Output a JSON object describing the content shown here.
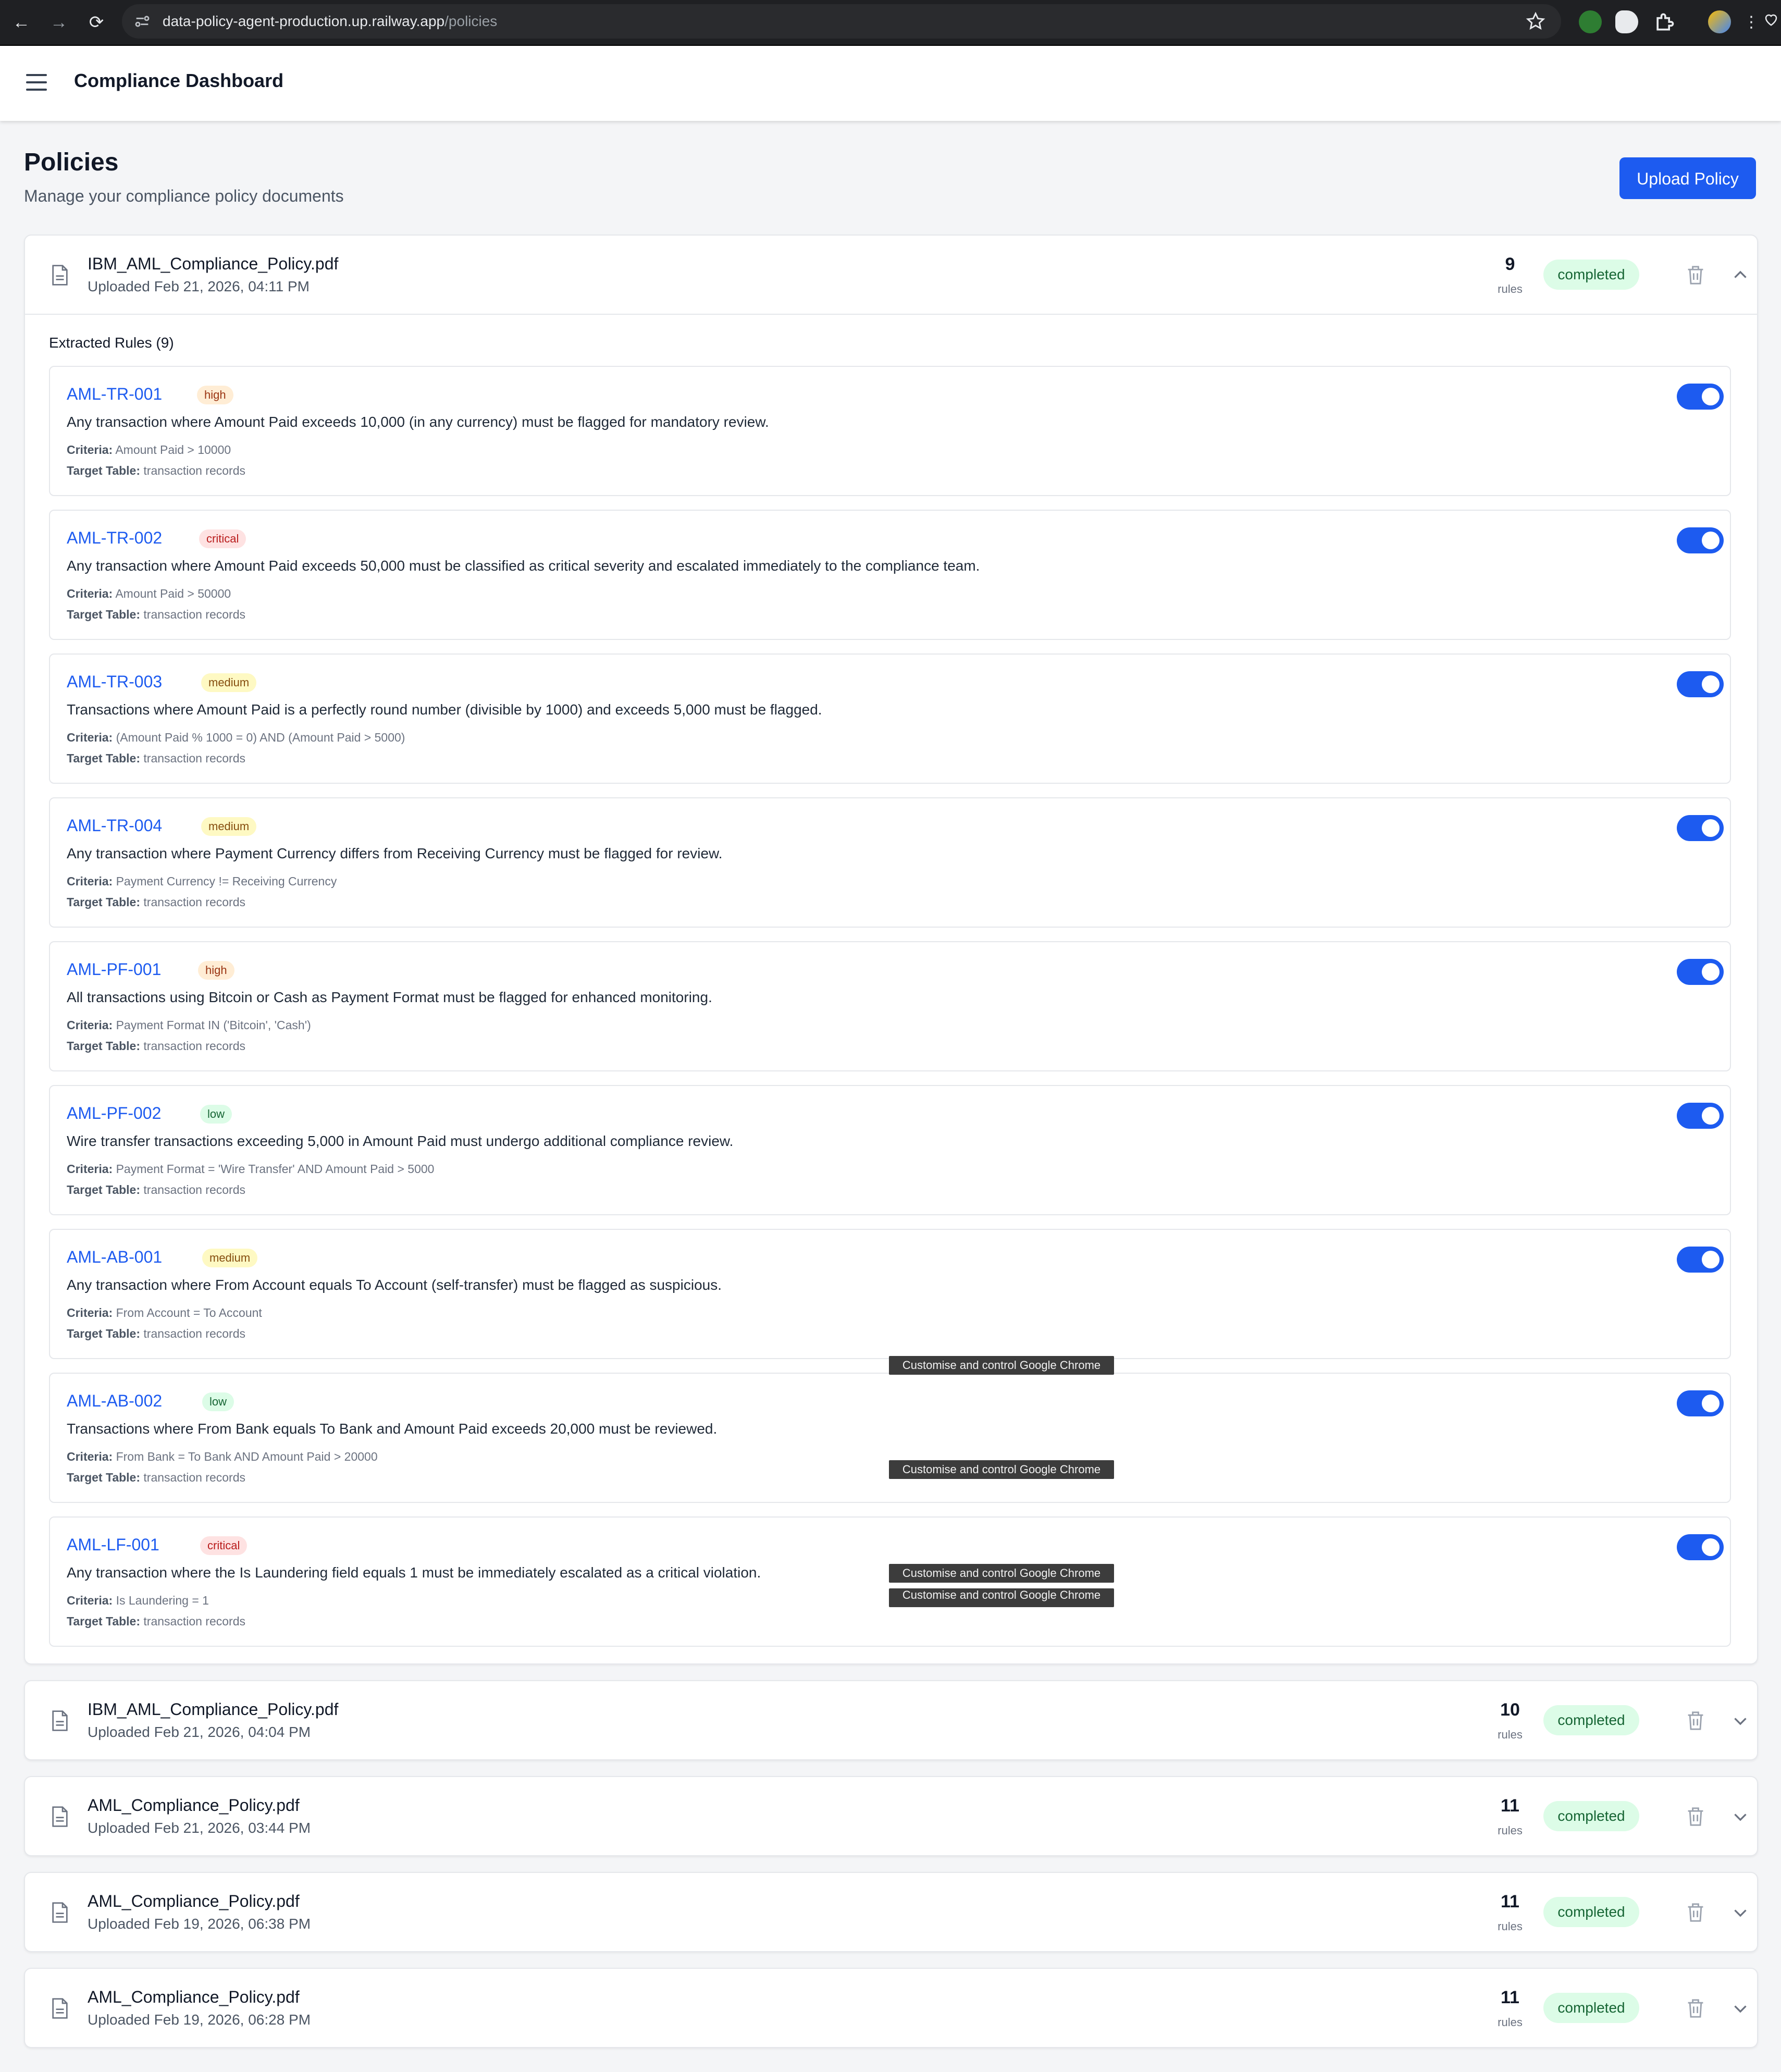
{
  "browser": {
    "url_host": "data-policy-agent-production.up.railway.app",
    "url_path": "/policies"
  },
  "app": {
    "title": "Compliance Dashboard"
  },
  "page": {
    "title": "Policies",
    "subtitle": "Manage your compliance policy documents",
    "upload_label": "Upload Policy"
  },
  "policies": [
    {
      "name": "IBM_AML_Compliance_Policy.pdf",
      "uploaded": "Uploaded Feb 21, 2026, 04:11 PM",
      "rule_count": "9",
      "rules_label": "rules",
      "status": "completed",
      "expanded": true,
      "rules_title": "Extracted Rules (9)",
      "rules": [
        {
          "id": "AML-TR-001",
          "severity": "high",
          "description": "Any transaction where Amount Paid exceeds 10,000 (in any currency) must be flagged for mandatory review.",
          "criteria_label": "Criteria:",
          "criteria": "Amount Paid > 10000",
          "table_label": "Target Table:",
          "table": "transaction records",
          "enabled": true
        },
        {
          "id": "AML-TR-002",
          "severity": "critical",
          "description": "Any transaction where Amount Paid exceeds 50,000 must be classified as critical severity and escalated immediately to the compliance team.",
          "criteria_label": "Criteria:",
          "criteria": "Amount Paid > 50000",
          "table_label": "Target Table:",
          "table": "transaction records",
          "enabled": true
        },
        {
          "id": "AML-TR-003",
          "severity": "medium",
          "description": "Transactions where Amount Paid is a perfectly round number (divisible by 1000) and exceeds 5,000 must be flagged.",
          "criteria_label": "Criteria:",
          "criteria": "(Amount Paid % 1000 = 0) AND (Amount Paid > 5000)",
          "table_label": "Target Table:",
          "table": "transaction records",
          "enabled": true
        },
        {
          "id": "AML-TR-004",
          "severity": "medium",
          "description": "Any transaction where Payment Currency differs from Receiving Currency must be flagged for review.",
          "criteria_label": "Criteria:",
          "criteria": "Payment Currency != Receiving Currency",
          "table_label": "Target Table:",
          "table": "transaction records",
          "enabled": true
        },
        {
          "id": "AML-PF-001",
          "severity": "high",
          "description": "All transactions using Bitcoin or Cash as Payment Format must be flagged for enhanced monitoring.",
          "criteria_label": "Criteria:",
          "criteria": "Payment Format IN ('Bitcoin', 'Cash')",
          "table_label": "Target Table:",
          "table": "transaction records",
          "enabled": true
        },
        {
          "id": "AML-PF-002",
          "severity": "low",
          "description": "Wire transfer transactions exceeding 5,000 in Amount Paid must undergo additional compliance review.",
          "criteria_label": "Criteria:",
          "criteria": "Payment Format = 'Wire Transfer' AND Amount Paid > 5000",
          "table_label": "Target Table:",
          "table": "transaction records",
          "enabled": true
        },
        {
          "id": "AML-AB-001",
          "severity": "medium",
          "description": "Any transaction where From Account equals To Account (self-transfer) must be flagged as suspicious.",
          "criteria_label": "Criteria:",
          "criteria": "From Account = To Account",
          "table_label": "Target Table:",
          "table": "transaction records",
          "enabled": true
        },
        {
          "id": "AML-AB-002",
          "severity": "low",
          "description": "Transactions where From Bank equals To Bank and Amount Paid exceeds 20,000 must be reviewed.",
          "criteria_label": "Criteria:",
          "criteria": "From Bank = To Bank AND Amount Paid > 20000",
          "table_label": "Target Table:",
          "table": "transaction records",
          "enabled": true
        },
        {
          "id": "AML-LF-001",
          "severity": "critical",
          "description": "Any transaction where the Is Laundering field equals 1 must be immediately escalated as a critical violation.",
          "criteria_label": "Criteria:",
          "criteria": "Is Laundering = 1",
          "table_label": "Target Table:",
          "table": "transaction records",
          "enabled": true
        }
      ]
    },
    {
      "name": "IBM_AML_Compliance_Policy.pdf",
      "uploaded": "Uploaded Feb 21, 2026, 04:04 PM",
      "rule_count": "10",
      "rules_label": "rules",
      "status": "completed",
      "expanded": false
    },
    {
      "name": "AML_Compliance_Policy.pdf",
      "uploaded": "Uploaded Feb 21, 2026, 03:44 PM",
      "rule_count": "11",
      "rules_label": "rules",
      "status": "completed",
      "expanded": false
    },
    {
      "name": "AML_Compliance_Policy.pdf",
      "uploaded": "Uploaded Feb 19, 2026, 06:38 PM",
      "rule_count": "11",
      "rules_label": "rules",
      "status": "completed",
      "expanded": false
    },
    {
      "name": "AML_Compliance_Policy.pdf",
      "uploaded": "Uploaded Feb 19, 2026, 06:28 PM",
      "rule_count": "11",
      "rules_label": "rules",
      "status": "completed",
      "expanded": false
    }
  ],
  "tooltips": [
    "Customise and control Google Chrome",
    "Customise and control Google Chrome",
    "Customise and control Google Chrome",
    "Customise and control Google Chrome"
  ],
  "colors": {
    "accent": "#1d5bf0",
    "status_completed_bg": "#dcfce7",
    "status_completed_fg": "#166534",
    "severity_high": "#ffedd5",
    "severity_critical": "#fee2e2",
    "severity_medium": "#fef9c3",
    "severity_low": "#dcfce7"
  },
  "icons": {
    "back": "arrow-left-icon",
    "forward": "arrow-right-icon",
    "reload": "reload-icon",
    "site_info": "site-info-icon",
    "bookmark": "star-icon",
    "menu": "hamburger-menu-icon",
    "document": "document-icon",
    "delete": "trash-icon",
    "collapse": "chevron-up-icon",
    "expand": "chevron-down-icon"
  }
}
